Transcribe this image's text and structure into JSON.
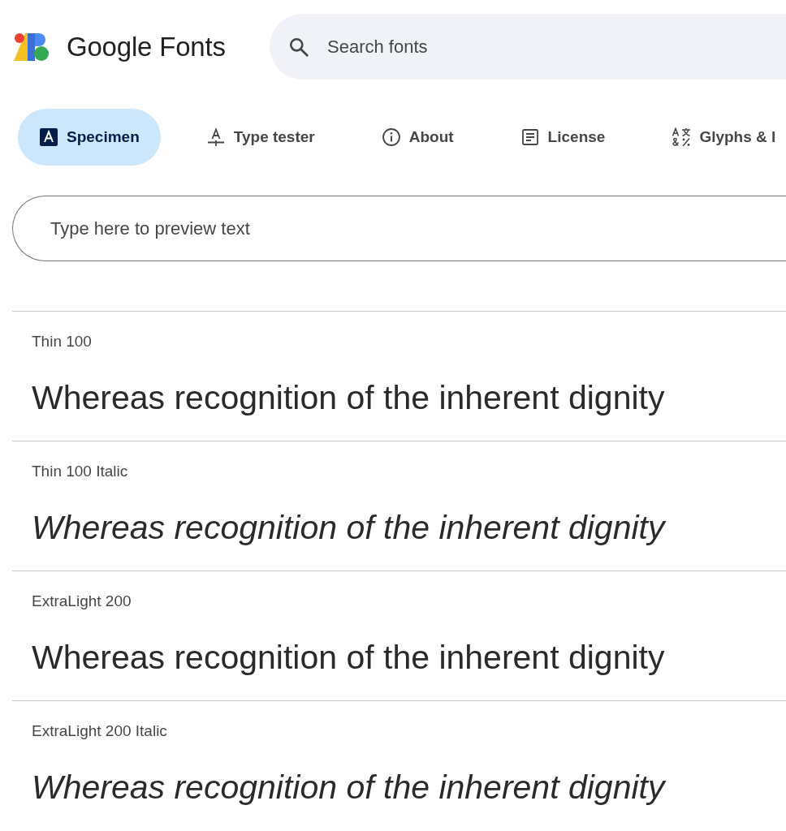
{
  "header": {
    "logo_text": "Google Fonts",
    "search": {
      "placeholder": "Search fonts"
    }
  },
  "tabs": [
    {
      "kind": "specimen",
      "label": "Specimen",
      "selected": true
    },
    {
      "kind": "type_tester",
      "label": "Type tester",
      "selected": false
    },
    {
      "kind": "about",
      "label": "About",
      "selected": false
    },
    {
      "kind": "license",
      "label": "License",
      "selected": false
    },
    {
      "kind": "glyphs",
      "label": "Glyphs & l",
      "selected": false
    }
  ],
  "preview": {
    "placeholder": "Type here to preview text"
  },
  "styles": [
    {
      "name": "Thin 100",
      "italic": false,
      "sample": "Whereas recognition of the inherent dignity"
    },
    {
      "name": "Thin 100 Italic",
      "italic": true,
      "sample": "Whereas recognition of the inherent dignity"
    },
    {
      "name": "ExtraLight 200",
      "italic": false,
      "sample": "Whereas recognition of the inherent dignity"
    },
    {
      "name": "ExtraLight 200 Italic",
      "italic": true,
      "sample": "Whereas recognition of the inherent dignity"
    }
  ]
}
